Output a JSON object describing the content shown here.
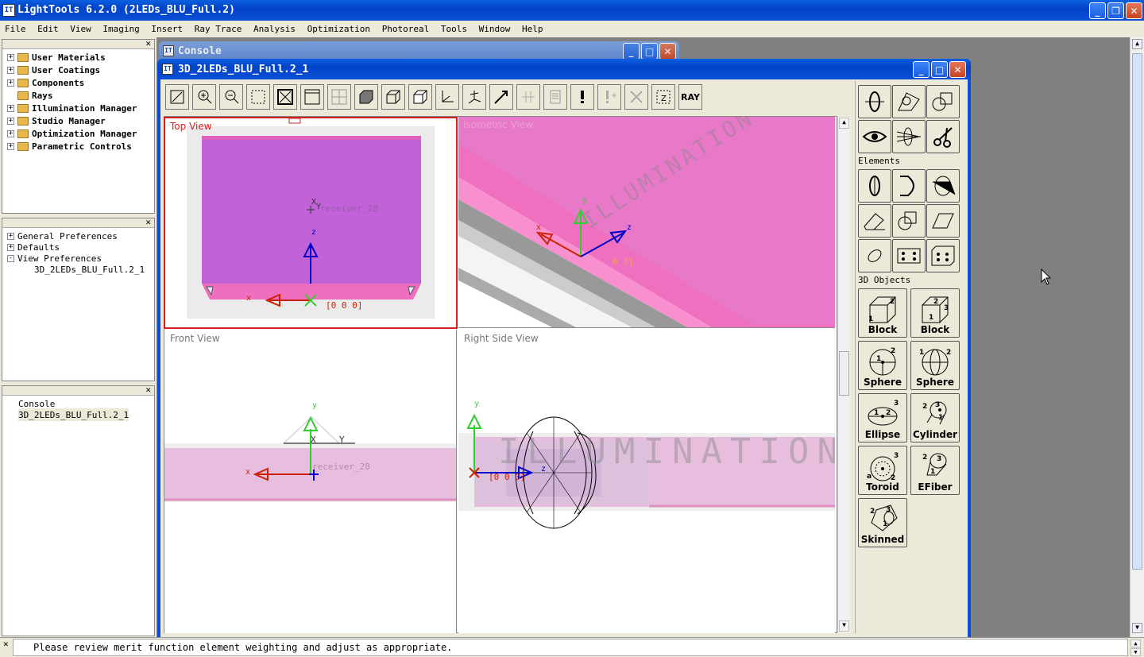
{
  "app": {
    "title": "LightTools 6.2.0  (2LEDs_BLU_Full.2)",
    "icon": "lt-icon"
  },
  "menu": [
    "File",
    "Edit",
    "View",
    "Imaging",
    "Insert",
    "Ray Trace",
    "Analysis",
    "Optimization",
    "Photoreal",
    "Tools",
    "Window",
    "Help"
  ],
  "tree1": [
    {
      "label": "User Materials"
    },
    {
      "label": "User Coatings"
    },
    {
      "label": "Components"
    },
    {
      "label": "Rays"
    },
    {
      "label": "Illumination Manager"
    },
    {
      "label": "Studio Manager"
    },
    {
      "label": "Optimization Manager"
    },
    {
      "label": "Parametric Controls"
    }
  ],
  "tree2": [
    {
      "label": "General Preferences",
      "expander": "+"
    },
    {
      "label": "Defaults",
      "expander": "+"
    },
    {
      "label": "View Preferences",
      "expander": "-"
    },
    {
      "label": "3D_2LEDs_BLU_Full.2_1",
      "expander": ""
    }
  ],
  "tree3": [
    {
      "label": "Console"
    },
    {
      "label": "3D_2LEDs_BLU_Full.2_1"
    }
  ],
  "console_window": {
    "title": "Console"
  },
  "view_window": {
    "title": "3D_2LEDs_BLU_Full.2_1"
  },
  "viewports": {
    "top": {
      "label": "Top View",
      "receiver": "receiver_28",
      "origin": "[0 0 0]"
    },
    "persp": {
      "label": "Isometric View",
      "origin": "0 0]",
      "watermark": "ILLUMINATION"
    },
    "front": {
      "label": "Front View",
      "receiver": "receiver_28"
    },
    "right": {
      "label": "Right Side View",
      "origin": "[0 0 0]",
      "watermark": "ILLUMINATION"
    }
  },
  "palette": {
    "elements_label": "Elements",
    "objects_label": "3D Objects",
    "objects": [
      {
        "label": "Block",
        "icon": "block-icon"
      },
      {
        "label": "Block",
        "icon": "block-icon"
      },
      {
        "label": "Sphere",
        "icon": "sphere-icon"
      },
      {
        "label": "Sphere",
        "icon": "sphere-icon"
      },
      {
        "label": "Ellipse",
        "icon": "ellipse-icon"
      },
      {
        "label": "Cylinder",
        "icon": "cylinder-icon"
      },
      {
        "label": "Toroid",
        "icon": "toroid-icon"
      },
      {
        "label": "EFiber",
        "icon": "efiber-icon"
      },
      {
        "label": "Skinned",
        "icon": "skinned-icon"
      }
    ]
  },
  "toolbar": {
    "ray_label": "RAY"
  },
  "status": {
    "message": "Please review merit function element weighting and adjust as appropriate."
  },
  "axis_labels": {
    "x": "x",
    "y": "y",
    "z": "z",
    "X": "X",
    "Y": "Y"
  }
}
